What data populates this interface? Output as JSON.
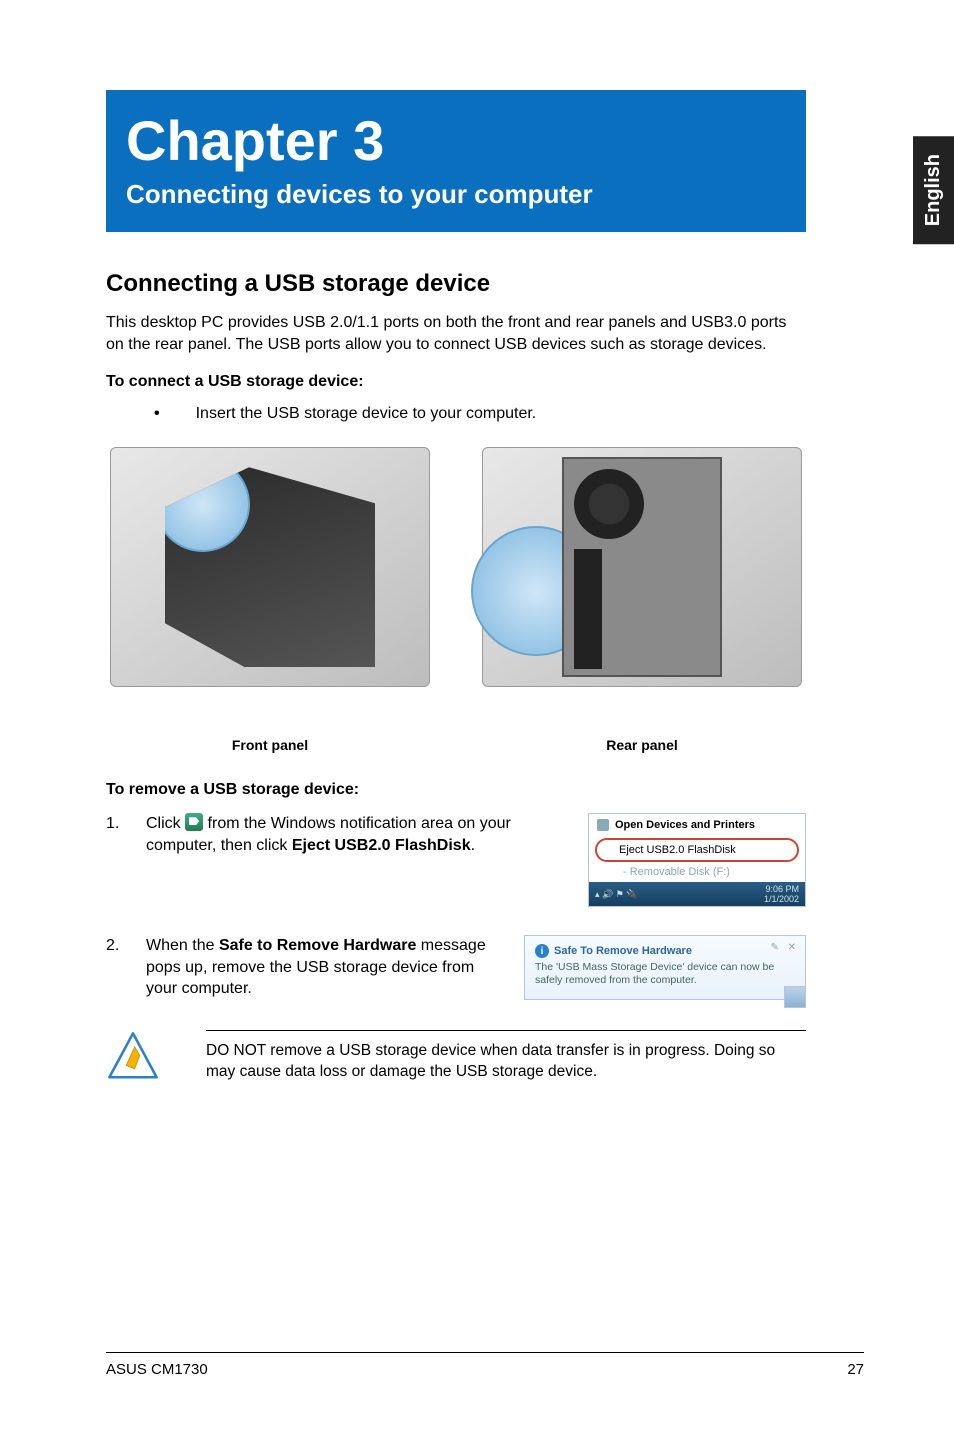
{
  "side_tab": "English",
  "chapter": {
    "title": "Chapter 3",
    "subtitle": "Connecting devices to your computer"
  },
  "section_heading": "Connecting a USB storage device",
  "intro_para": "This desktop PC provides USB 2.0/1.1 ports on both the front and rear panels and USB3.0 ports on the rear panel. The USB ports allow you to connect USB devices such as storage devices.",
  "connect_heading": "To connect a USB storage device:",
  "connect_bullet": "Insert the USB storage device to your computer.",
  "captions": {
    "front": "Front panel",
    "rear": "Rear panel"
  },
  "remove_heading": "To remove a USB storage device:",
  "steps": [
    {
      "num": "1.",
      "pre": "Click ",
      "mid": " from the Windows notification area on your computer, then click ",
      "bold": "Eject USB2.0 FlashDisk",
      "post": "."
    },
    {
      "num": "2.",
      "pre": "When the ",
      "bold": "Safe to Remove Hardware",
      "post": " message pops up, remove the USB storage device from your computer."
    }
  ],
  "eject_popup": {
    "open": "Open Devices and Printers",
    "eject": "Eject USB2.0 FlashDisk",
    "removable": "- Removable Disk (F:)",
    "time": "9:06 PM",
    "date": "1/1/2002"
  },
  "safe_popup": {
    "title": "Safe To Remove Hardware",
    "msg": "The 'USB Mass Storage Device' device can now be safely removed from the computer."
  },
  "warning": "DO NOT remove a USB storage device when data transfer is in progress. Doing so may cause data loss or damage the USB storage device.",
  "footer": {
    "model": "ASUS CM1730",
    "page": "27"
  }
}
